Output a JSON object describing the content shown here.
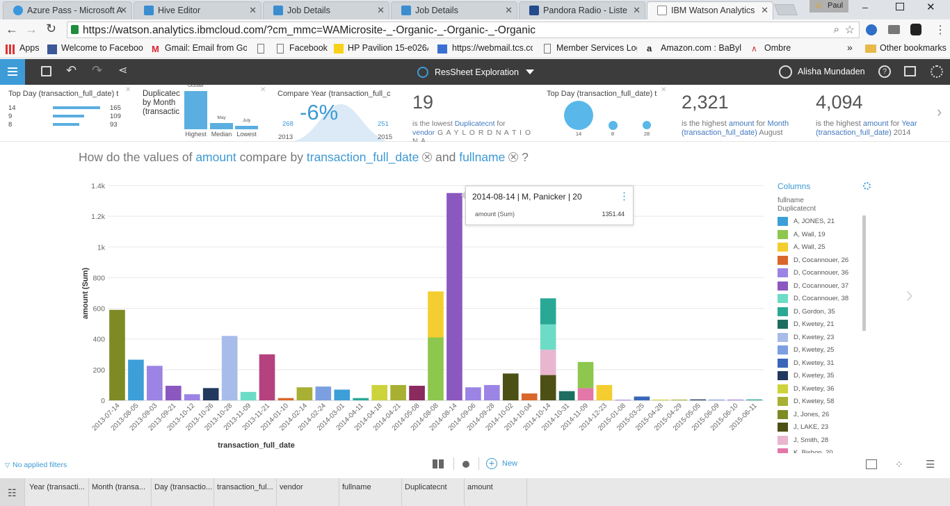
{
  "browser": {
    "tabs": [
      {
        "label": "Azure Pass - Microsoft A",
        "color": "#3a96dd"
      },
      {
        "label": "Hive Editor",
        "color": "#3a8ed0"
      },
      {
        "label": "Job Details",
        "color": "#3a8ed0"
      },
      {
        "label": "Job Details",
        "color": "#3a8ed0"
      },
      {
        "label": "Pandora Radio - Liste",
        "color": "#234a8c"
      },
      {
        "label": "IBM Watson Analytics",
        "color": "#888888"
      }
    ],
    "profile_name": "Paul",
    "url": "https://watson.analytics.ibmcloud.com/?cm_mmc=WAMicrosite-_-Organic-_-Organic-_-Organic",
    "bookmarks": [
      "Apps",
      "Welcome to Facebook",
      "Gmail: Email from Goo",
      "",
      "Facebook",
      "HP Pavilion 15-e026A",
      "https://webmail.tcs.co",
      "Member Services Logi",
      "Amazon.com : BaBylis",
      "Ombre"
    ],
    "other_bookmarks": "Other bookmarks",
    "more_glyph": "»"
  },
  "appbar": {
    "title": "ResSheet Exploration",
    "user": "Alisha Mundaden"
  },
  "insights": {
    "card1": {
      "title": "Top Day (transaction_full_date) t",
      "rows": [
        {
          "label": "14",
          "value": "165",
          "frac": 1.0
        },
        {
          "label": "9",
          "value": "109",
          "frac": 0.66
        },
        {
          "label": "8",
          "value": "93",
          "frac": 0.56
        }
      ]
    },
    "card2": {
      "title1": "Duplicatec",
      "title2": "by Month",
      "title3": "(transactic",
      "bars": [
        {
          "top": "October",
          "label": "Highest",
          "frac": 1.0
        },
        {
          "top": "May",
          "label": "Median",
          "frac": 0.17
        },
        {
          "top": "July",
          "label": "Lowest",
          "frac": 0.09
        }
      ]
    },
    "card3": {
      "title": "Compare Year (transaction_full_c",
      "pct": "-6%",
      "left_val": "268",
      "right_val": "251",
      "left_year": "2013",
      "right_year": "2015"
    },
    "card4": {
      "big": "19",
      "t1": "is the lowest ",
      "t2": "Duplicatecnt",
      "t3": " for",
      "t4": "vendor",
      "t5": " G A Y L O R D N A T I O N A"
    },
    "card5": {
      "title": "Top Day (transaction_full_date) t",
      "bubbles": [
        {
          "label": "14",
          "size": 1.0
        },
        {
          "label": "8",
          "size": 0.3
        },
        {
          "label": "28",
          "size": 0.28
        }
      ]
    },
    "card6": {
      "big": "2,321",
      "t1": "is the highest ",
      "t2": "amount",
      "t3": " for ",
      "t4": "Month",
      "t5": "(transaction_full_date)",
      "t6": " August"
    },
    "card7": {
      "big": "4,094",
      "t1": "is the highest ",
      "t2": "amount",
      "t3": " for ",
      "t4": "Year",
      "t5": "(transaction_full_date)",
      "t6": " 2014"
    }
  },
  "question": {
    "prefix": "How do the values of",
    "measure": "amount",
    "mid": "compare by",
    "dim1": "transaction_full_date",
    "and": "and",
    "dim2": "fullname",
    "suffix": "?"
  },
  "tooltip": {
    "title": "2014-08-14 | M, Panicker | 20",
    "label": "amount (Sum)",
    "value": "1351.44"
  },
  "legend": {
    "title": "Columns",
    "sub1": "fullname",
    "sub2": "Duplicatecnt",
    "items": [
      {
        "label": "A, JONES, 21",
        "color": "#3d9fd8"
      },
      {
        "label": "A, Wall, 19",
        "color": "#8dc74d"
      },
      {
        "label": "A, Wall, 25",
        "color": "#f4cd30"
      },
      {
        "label": "D, Cocannouer, 26",
        "color": "#d9672b"
      },
      {
        "label": "D, Cocannouer, 36",
        "color": "#9b84e4"
      },
      {
        "label": "D, Cocannouer, 37",
        "color": "#8b58c0"
      },
      {
        "label": "D, Cocannouer, 38",
        "color": "#6ddcc6"
      },
      {
        "label": "D, Gordon, 35",
        "color": "#2aa896"
      },
      {
        "label": "D, Kwetey, 21",
        "color": "#1d6e60"
      },
      {
        "label": "D, Kwetey, 23",
        "color": "#a7bce9"
      },
      {
        "label": "D, Kwetey, 25",
        "color": "#7b9fe0"
      },
      {
        "label": "D, Kwetey, 31",
        "color": "#3966b8"
      },
      {
        "label": "D, Kwetey, 35",
        "color": "#22385e"
      },
      {
        "label": "D, Kwetey, 36",
        "color": "#cdd33a"
      },
      {
        "label": "D, Kwetey, 58",
        "color": "#a8b033"
      },
      {
        "label": "J, Jones, 26",
        "color": "#7e8a24"
      },
      {
        "label": "J, LAKE, 23",
        "color": "#4d5015"
      },
      {
        "label": "J, Smith, 28",
        "color": "#e9b6d0"
      },
      {
        "label": "K, Bishop, 20",
        "color": "#e277a8"
      }
    ]
  },
  "chart_data": {
    "type": "bar",
    "stacked": true,
    "xlabel": "transaction_full_date",
    "ylabel": "amount (Sum)",
    "ylim": [
      0,
      1400
    ],
    "yticks": [
      "0",
      "200",
      "400",
      "600",
      "800",
      "1k",
      "1.2k",
      "1.4k"
    ],
    "categories": [
      "2013-07-14",
      "2013-08-05",
      "2013-09-03",
      "2013-09-21",
      "2013-10-12",
      "2013-10-26",
      "2013-10-28",
      "2013-11-09",
      "2013-11-21",
      "2014-01-10",
      "2014-02-14",
      "2014-02-24",
      "2014-03-01",
      "2014-04-11",
      "2014-04-18",
      "2014-04-21",
      "2014-05-08",
      "2014-08-08",
      "2014-08-14",
      "2014-09-06",
      "2014-09-28",
      "2014-10-02",
      "2014-10-04",
      "2014-10-14",
      "2014-10-31",
      "2014-11-09",
      "2014-12-23",
      "2015-01-08",
      "2015-03-25",
      "2015-04-28",
      "2015-04-29",
      "2015-05-05",
      "2015-06-09",
      "2015-06-10",
      "2015-06-11"
    ],
    "stacks": [
      [
        {
          "v": 590,
          "c": "#7e8a24"
        }
      ],
      [
        {
          "v": 265,
          "c": "#3d9fd8"
        }
      ],
      [
        {
          "v": 225,
          "c": "#9b84e4"
        }
      ],
      [
        {
          "v": 95,
          "c": "#8b58c0"
        }
      ],
      [
        {
          "v": 40,
          "c": "#9b84e4"
        }
      ],
      [
        {
          "v": 80,
          "c": "#22385e"
        }
      ],
      [
        {
          "v": 420,
          "c": "#a7bce9"
        }
      ],
      [
        {
          "v": 55,
          "c": "#6ddcc6"
        }
      ],
      [
        {
          "v": 300,
          "c": "#b5427f"
        }
      ],
      [
        {
          "v": 15,
          "c": "#d9672b"
        }
      ],
      [
        {
          "v": 85,
          "c": "#a8b033"
        }
      ],
      [
        {
          "v": 90,
          "c": "#7b9fe0"
        }
      ],
      [
        {
          "v": 70,
          "c": "#3d9fd8"
        }
      ],
      [
        {
          "v": 15,
          "c": "#2aa896"
        }
      ],
      [
        {
          "v": 100,
          "c": "#cdd33a"
        }
      ],
      [
        {
          "v": 100,
          "c": "#a8b033"
        }
      ],
      [
        {
          "v": 95,
          "c": "#8a2a5e"
        }
      ],
      [
        {
          "v": 410,
          "c": "#8dc74d"
        },
        {
          "v": 300,
          "c": "#f4cd30"
        }
      ],
      [
        {
          "v": 1351.44,
          "c": "#8b58c0"
        }
      ],
      [
        {
          "v": 85,
          "c": "#9b84e4"
        }
      ],
      [
        {
          "v": 100,
          "c": "#9b84e4"
        }
      ],
      [
        {
          "v": 175,
          "c": "#4d5015"
        }
      ],
      [
        {
          "v": 45,
          "c": "#d9672b"
        }
      ],
      [
        {
          "v": 165,
          "c": "#4d5015"
        },
        {
          "v": 165,
          "c": "#e9b6d0"
        },
        {
          "v": 165,
          "c": "#6ddcc6"
        },
        {
          "v": 170,
          "c": "#2aa896"
        }
      ],
      [
        {
          "v": 60,
          "c": "#1d6e60"
        }
      ],
      [
        {
          "v": 80,
          "c": "#e277a8"
        },
        {
          "v": 170,
          "c": "#8dc74d"
        }
      ],
      [
        {
          "v": 100,
          "c": "#f4cd30"
        }
      ],
      [
        {
          "v": 4,
          "c": "#9b84e4"
        }
      ],
      [
        {
          "v": 25,
          "c": "#3966b8"
        }
      ],
      [
        {
          "v": 5,
          "c": "#cdd33a"
        }
      ],
      [
        {
          "v": 5,
          "c": "#a8b033"
        }
      ],
      [
        {
          "v": 6,
          "c": "#22385e"
        }
      ],
      [
        {
          "v": 5,
          "c": "#7b9fe0"
        }
      ],
      [
        {
          "v": 5,
          "c": "#9b84e4"
        }
      ],
      [
        {
          "v": 6,
          "c": "#2aa896"
        }
      ]
    ]
  },
  "footer": {
    "filters": "No applied filters",
    "new": "New"
  },
  "columns": [
    "Year (transacti...",
    "Month (transa...",
    "Day (transactio...",
    "transaction_ful...",
    "vendor",
    "fullname",
    "Duplicatecnt",
    "amount"
  ]
}
